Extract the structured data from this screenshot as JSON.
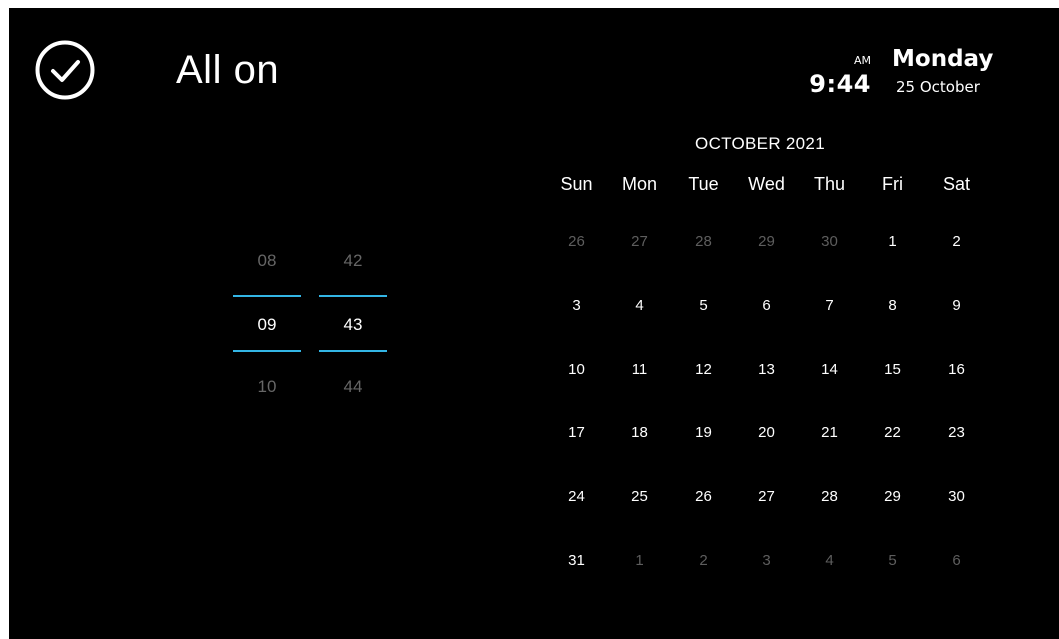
{
  "header": {
    "title": "All on",
    "check_icon": "check-circle-icon"
  },
  "clock": {
    "ampm": "AM",
    "time": "9:44",
    "day_name": "Monday",
    "date": "25 October"
  },
  "time_picker": {
    "hours": {
      "prev": "08",
      "current": "09",
      "next": "10"
    },
    "minutes": {
      "prev": "42",
      "current": "43",
      "next": "44"
    },
    "accent_color": "#33b5e5"
  },
  "calendar": {
    "month_label": "OCTOBER 2021",
    "weekdays": [
      "Sun",
      "Mon",
      "Tue",
      "Wed",
      "Thu",
      "Fri",
      "Sat"
    ],
    "weeks": [
      [
        {
          "d": "26",
          "in": false
        },
        {
          "d": "27",
          "in": false
        },
        {
          "d": "28",
          "in": false
        },
        {
          "d": "29",
          "in": false
        },
        {
          "d": "30",
          "in": false
        },
        {
          "d": "1",
          "in": true
        },
        {
          "d": "2",
          "in": true
        }
      ],
      [
        {
          "d": "3",
          "in": true
        },
        {
          "d": "4",
          "in": true
        },
        {
          "d": "5",
          "in": true
        },
        {
          "d": "6",
          "in": true
        },
        {
          "d": "7",
          "in": true
        },
        {
          "d": "8",
          "in": true
        },
        {
          "d": "9",
          "in": true
        }
      ],
      [
        {
          "d": "10",
          "in": true
        },
        {
          "d": "11",
          "in": true
        },
        {
          "d": "12",
          "in": true
        },
        {
          "d": "13",
          "in": true
        },
        {
          "d": "14",
          "in": true
        },
        {
          "d": "15",
          "in": true
        },
        {
          "d": "16",
          "in": true
        }
      ],
      [
        {
          "d": "17",
          "in": true
        },
        {
          "d": "18",
          "in": true
        },
        {
          "d": "19",
          "in": true
        },
        {
          "d": "20",
          "in": true
        },
        {
          "d": "21",
          "in": true
        },
        {
          "d": "22",
          "in": true
        },
        {
          "d": "23",
          "in": true
        }
      ],
      [
        {
          "d": "24",
          "in": true
        },
        {
          "d": "25",
          "in": true
        },
        {
          "d": "26",
          "in": true
        },
        {
          "d": "27",
          "in": true
        },
        {
          "d": "28",
          "in": true
        },
        {
          "d": "29",
          "in": true
        },
        {
          "d": "30",
          "in": true
        }
      ],
      [
        {
          "d": "31",
          "in": true
        },
        {
          "d": "1",
          "in": false
        },
        {
          "d": "2",
          "in": false
        },
        {
          "d": "3",
          "in": false
        },
        {
          "d": "4",
          "in": false
        },
        {
          "d": "5",
          "in": false
        },
        {
          "d": "6",
          "in": false
        }
      ]
    ]
  }
}
